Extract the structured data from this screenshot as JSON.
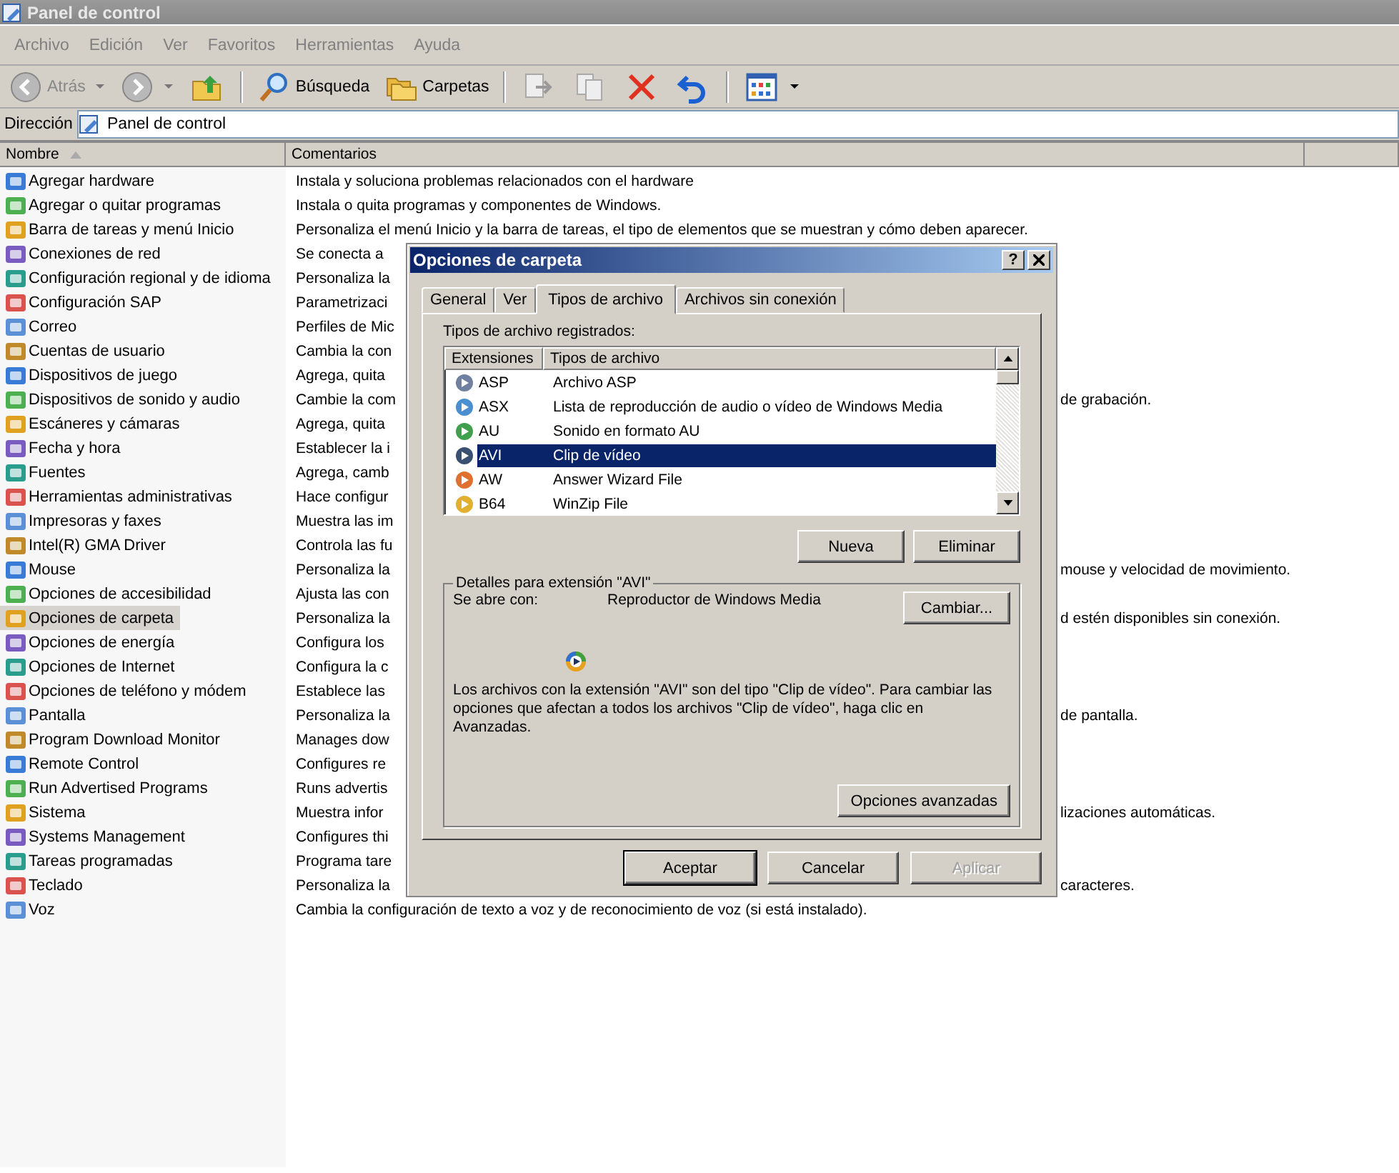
{
  "window": {
    "title": "Panel de control"
  },
  "menu": [
    "Archivo",
    "Edición",
    "Ver",
    "Favoritos",
    "Herramientas",
    "Ayuda"
  ],
  "toolbar": {
    "back": {
      "label": "Atrás",
      "disabled": true
    },
    "forward": {
      "disabled": true
    },
    "search": {
      "label": "Búsqueda"
    },
    "folders": {
      "label": "Carpetas"
    }
  },
  "address": {
    "label": "Dirección",
    "value": "Panel de control"
  },
  "columns": [
    {
      "label": "Nombre",
      "sorted": true
    },
    {
      "label": "Comentarios",
      "sorted": false
    }
  ],
  "items": [
    {
      "name": "Agregar hardware",
      "comment": "Instala y soluciona problemas relacionados con el hardware",
      "selected": false
    },
    {
      "name": "Agregar o quitar programas",
      "comment": "Instala o quita programas y componentes de Windows.",
      "selected": false
    },
    {
      "name": "Barra de tareas y menú Inicio",
      "comment": "Personaliza el menú Inicio y la barra de tareas, el tipo de elementos que se muestran y cómo deben aparecer.",
      "selected": false
    },
    {
      "name": "Conexiones de red",
      "comment": "Se conecta a",
      "selected": false
    },
    {
      "name": "Configuración regional y de idioma",
      "comment": "Personaliza la",
      "selected": false
    },
    {
      "name": "Configuración SAP",
      "comment": "Parametrizaci",
      "selected": false
    },
    {
      "name": "Correo",
      "comment": "Perfiles de Mic",
      "selected": false
    },
    {
      "name": "Cuentas de usuario",
      "comment": "Cambia la con",
      "selected": false
    },
    {
      "name": "Dispositivos de juego",
      "comment": "Agrega, quita",
      "selected": false
    },
    {
      "name": "Dispositivos de sonido y audio",
      "comment": "Cambie la com",
      "comment_end": "de grabación.",
      "selected": false
    },
    {
      "name": "Escáneres y cámaras",
      "comment": "Agrega, quita",
      "selected": false
    },
    {
      "name": "Fecha y hora",
      "comment": "Establecer la i",
      "selected": false
    },
    {
      "name": "Fuentes",
      "comment": "Agrega, camb",
      "selected": false
    },
    {
      "name": "Herramientas administrativas",
      "comment": "Hace configur",
      "selected": false
    },
    {
      "name": "Impresoras y faxes",
      "comment": "Muestra las im",
      "selected": false
    },
    {
      "name": "Intel(R) GMA Driver",
      "comment": "Controla las fu",
      "selected": false
    },
    {
      "name": "Mouse",
      "comment": "Personaliza la",
      "comment_end": "mouse y velocidad de movimiento.",
      "selected": false
    },
    {
      "name": "Opciones de accesibilidad",
      "comment": "Ajusta las con",
      "selected": false
    },
    {
      "name": "Opciones de carpeta",
      "comment": "Personaliza la",
      "comment_end": "d estén disponibles sin conexión.",
      "selected": true
    },
    {
      "name": "Opciones de energía",
      "comment": "Configura los",
      "selected": false
    },
    {
      "name": "Opciones de Internet",
      "comment": "Configura la c",
      "selected": false
    },
    {
      "name": "Opciones de teléfono y módem",
      "comment": "Establece las",
      "selected": false
    },
    {
      "name": "Pantalla",
      "comment": "Personaliza la",
      "comment_end": "de pantalla.",
      "selected": false
    },
    {
      "name": "Program Download Monitor",
      "comment": "Manages dow",
      "selected": false
    },
    {
      "name": "Remote Control",
      "comment": "Configures re",
      "selected": false
    },
    {
      "name": "Run Advertised Programs",
      "comment": "Runs advertis",
      "selected": false
    },
    {
      "name": "Sistema",
      "comment": "Muestra infor",
      "comment_end": "lizaciones automáticas.",
      "selected": false
    },
    {
      "name": "Systems Management",
      "comment": "Configures thi",
      "selected": false
    },
    {
      "name": "Tareas programadas",
      "comment": "Programa tare",
      "selected": false
    },
    {
      "name": "Teclado",
      "comment": "Personaliza la",
      "comment_end": "caracteres.",
      "selected": false
    },
    {
      "name": "Voz",
      "comment": "Cambia la configuración de texto a voz y de reconocimiento de voz (si está instalado).",
      "selected": false
    }
  ],
  "dialog": {
    "title": "Opciones de carpeta",
    "help": "?",
    "tabs": [
      {
        "label": "General",
        "selected": false
      },
      {
        "label": "Ver",
        "selected": false
      },
      {
        "label": "Tipos de archivo",
        "selected": true
      },
      {
        "label": "Archivos sin conexión",
        "selected": false
      }
    ],
    "list_label": "Tipos de archivo registrados:",
    "list_columns": [
      "Extensiones",
      "Tipos de archivo"
    ],
    "file_types": [
      {
        "ext": "ASP",
        "type": "Archivo ASP",
        "selected": false
      },
      {
        "ext": "ASX",
        "type": "Lista de reproducción de audio o vídeo de Windows Media",
        "selected": false
      },
      {
        "ext": "AU",
        "type": "Sonido en formato AU",
        "selected": false
      },
      {
        "ext": "AVI",
        "type": "Clip de vídeo",
        "selected": true
      },
      {
        "ext": "AW",
        "type": "Answer Wizard File",
        "selected": false
      },
      {
        "ext": "B64",
        "type": "WinZip File",
        "selected": false
      }
    ],
    "list_buttons": [
      "Nueva",
      "Eliminar"
    ],
    "details": {
      "title": "Detalles para extensión \"AVI\"",
      "opens_with_label": "Se abre con:",
      "opens_with": "Reproductor de Windows Media",
      "change_button": "Cambiar...",
      "description": "Los archivos con la extensión \"AVI\" son del tipo \"Clip de vídeo\". Para cambiar las opciones que afectan a todos los archivos \"Clip de vídeo\", haga clic en Avanzadas.",
      "advanced_button": "Opciones avanzadas"
    },
    "buttons": [
      {
        "label": "Aceptar",
        "default": true,
        "disabled": false
      },
      {
        "label": "Cancelar",
        "default": false,
        "disabled": false
      },
      {
        "label": "Aplicar",
        "default": false,
        "disabled": true
      }
    ]
  }
}
